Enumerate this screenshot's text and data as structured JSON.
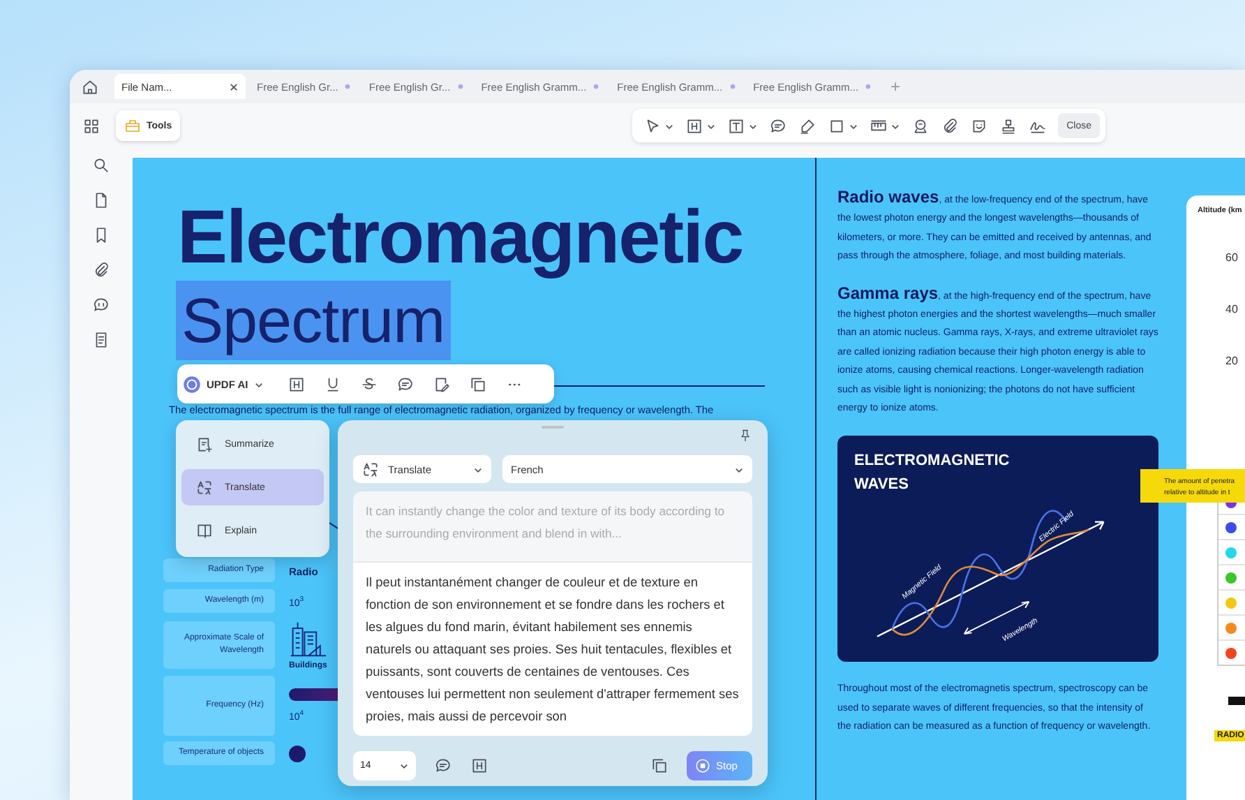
{
  "tabs": [
    {
      "label": "File Nam...",
      "selected": true,
      "closable": true
    },
    {
      "label": "Free English Gr...",
      "selected": false,
      "closable": false
    },
    {
      "label": "Free English Gr...",
      "selected": false,
      "closable": false
    },
    {
      "label": "Free English Gramm...",
      "selected": false,
      "closable": false
    },
    {
      "label": "Free English Gramm...",
      "selected": false,
      "closable": false
    },
    {
      "label": "Free English Gramm...",
      "selected": false,
      "closable": false
    }
  ],
  "new_tab": "+",
  "toolbar": {
    "tools_button": "Tools",
    "close_button": "Close"
  },
  "document": {
    "title_line1": "Electromagnetic",
    "title_line2": "Spectrum",
    "title_highlighted": true,
    "intro": "The electromagnetic spectrum is the full range of electromagnetic radiation, organized by frequency or wavelength. The",
    "table": [
      {
        "label": "Radiation Type",
        "value": "Radio",
        "kind": "bold"
      },
      {
        "label": "Wavelength (m)",
        "value": "10$^{3}$",
        "kind": "plain"
      },
      {
        "label": "Approximate Scale of Wavelength",
        "value": "Buildings",
        "kind": "icon"
      },
      {
        "label": "Frequency (Hz)",
        "value": "10$^{4}$",
        "kind": "bar"
      },
      {
        "label": "Temperature of objects",
        "kind": "dot"
      }
    ],
    "paragraphs": [
      "**Radio waves**, at the low-frequency end of the spectrum, have the lowest photon energy and the longest wavelengths—thousands of kilometers, or more. They can be emitted and received by antennas, and pass through the atmosphere, foliage, and most building materials.",
      "**Gamma rays**, at the high-frequency end of the spectrum, have the highest photon energies and the shortest wavelengths—much smaller than an atomic nucleus. Gamma rays, X-rays, and extreme ultraviolet rays are called ionizing radiation because their high photon energy is able to ionize atoms, causing chemical reactions. Longer-wavelength radiation such as visible light is nonionizing; the photons do not have sufficient energy to ionize atoms."
    ],
    "waves_card": {
      "title": "ELECTROMAGNETIC WAVES",
      "electric_label": "Electric Field",
      "magnetic_label": "Magnetic Field",
      "wavelength_label": "Wavelength"
    },
    "closing_paragraph": "Throughout most of the electromagnetis spectrum, spectroscopy can be used to separate waves of different frequencies, so that the intensity of the radiation can be measured as a function of frequency or wavelength.",
    "chart_panel": {
      "axis_title": "Altitude (km",
      "ticks": [
        "60",
        "40",
        "20"
      ],
      "note": [
        "The amount of penetra",
        "relative to altitude in t"
      ],
      "legend": [
        {
          "color": "#7a2ff0"
        },
        {
          "color": "#3b4cf0"
        },
        {
          "color": "#22d8ea"
        },
        {
          "color": "#3cc62a"
        },
        {
          "color": "#f4c70f"
        },
        {
          "color": "#f58a1f"
        },
        {
          "color": "#f2451c"
        }
      ],
      "tag": "RADIO"
    }
  },
  "ai_toolbar": {
    "label": "UPDF AI"
  },
  "ai_menu": [
    {
      "label": "Summarize",
      "selected": false,
      "kind": "summarize"
    },
    {
      "label": "Translate",
      "selected": true,
      "kind": "translate"
    },
    {
      "label": "Explain",
      "selected": false,
      "kind": "explain"
    }
  ],
  "translate_panel": {
    "mode": "Translate",
    "language": "French",
    "source_text": "It can instantly change the color and texture of its body according to the surrounding environment and blend in with...",
    "result": "Il peut instantanément changer de couleur et de texture en fonction de son environnement et se fondre dans les rochers et les algues du fond marin, évitant habilement ses ennemis naturels ou attaquant ses proies. Ses huit tentacules, flexibles et puissants, sont couverts de centaines de ventouses. Ces ventouses lui permettent non seulement d'attraper fermement ses proies, mais aussi de percevoir son",
    "font_size": "14",
    "stop_button": "Stop"
  }
}
